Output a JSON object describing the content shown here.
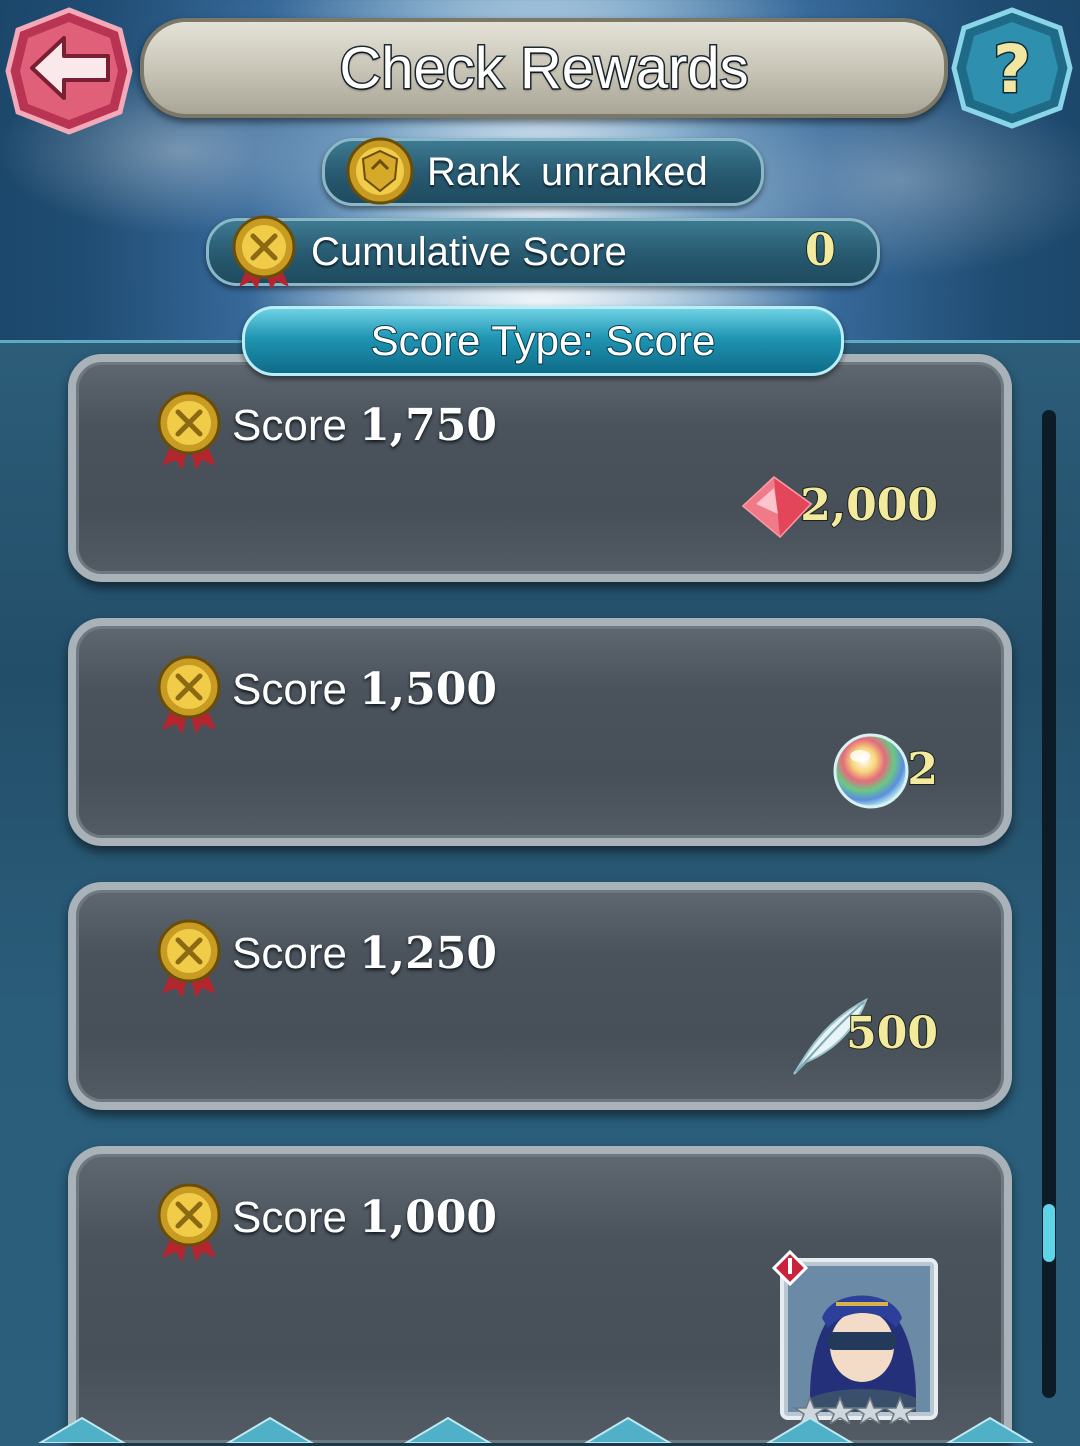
{
  "header": {
    "title": "Check Rewards"
  },
  "rank": {
    "label": "Rank",
    "value": "unranked"
  },
  "cumulative": {
    "label": "Cumulative Score",
    "value": "0"
  },
  "score_type": {
    "label": "Score Type: Score"
  },
  "rewards": [
    {
      "label": "Score",
      "score": "1,750",
      "reward_icon": "red-gem-icon",
      "quantity": "2,000"
    },
    {
      "label": "Score",
      "score": "1,500",
      "reward_icon": "orb-icon",
      "quantity": "2"
    },
    {
      "label": "Score",
      "score": "1,250",
      "reward_icon": "feather-icon",
      "quantity": "500"
    },
    {
      "label": "Score",
      "score": "1,000",
      "reward_icon": "hero-portrait-icon",
      "quantity": ""
    }
  ],
  "colors": {
    "accent_cyan": "#5fd3e8",
    "value_yellow": "#f4ea9d",
    "back_button": "#d8506a",
    "help_button": "#2f8fae"
  },
  "scroll": {
    "position_fraction": 0.8
  }
}
